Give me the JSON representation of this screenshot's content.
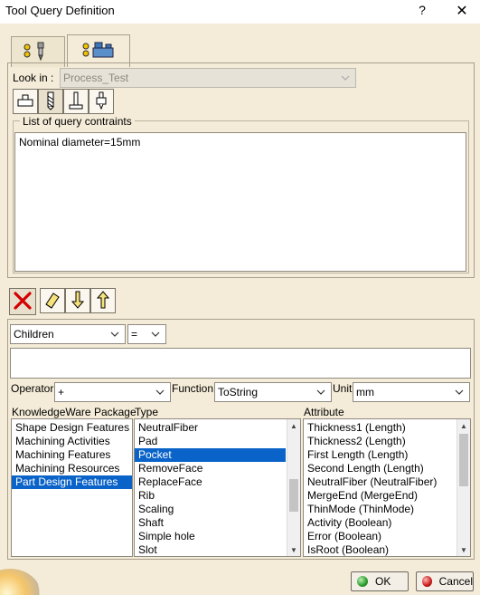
{
  "window": {
    "title": "Tool Query Definition",
    "help": "?",
    "close": "✕"
  },
  "tabs": [
    {
      "icon": "tool-assembly-icon"
    },
    {
      "icon": "machine-resource-icon"
    }
  ],
  "lookin": {
    "label": "Look in :",
    "value": "Process_Test"
  },
  "toolbar_top": [
    "tool-holder-icon",
    "drill-icon",
    "end-mill-icon",
    "insert-tool-icon"
  ],
  "constraints": {
    "legend": "List of query contraints",
    "items": [
      "Nominal diameter=15mm"
    ]
  },
  "toolbar_edit": [
    "delete-icon",
    "eraser-icon",
    "arrow-down-icon",
    "arrow-up-icon"
  ],
  "children_combo": {
    "value": "Children"
  },
  "operator_combo": {
    "value": "="
  },
  "expression_field": {
    "value": ""
  },
  "operator": {
    "label": "Operator",
    "value": "+"
  },
  "function": {
    "label": "Function",
    "value": "ToString"
  },
  "unit": {
    "label": "Unit",
    "value": "mm"
  },
  "kw_package": {
    "label": "KnowledgeWare Package",
    "items": [
      "Shape Design Features",
      "Machining Activities",
      "Machining Features",
      "Machining Resources",
      "Part Design Features"
    ],
    "selected": 4
  },
  "type_list": {
    "label": "Type",
    "items": [
      "NeutralFiber",
      "Pad",
      "Pocket",
      "RemoveFace",
      "ReplaceFace",
      "Rib",
      "Scaling",
      "Shaft",
      "Simple hole",
      "Slot"
    ],
    "selected": 2
  },
  "attribute_list": {
    "label": "Attribute",
    "items": [
      "Thickness1 (Length)",
      "Thickness2 (Length)",
      "First Length (Length)",
      "Second Length (Length)",
      "NeutralFiber (NeutralFiber)",
      "MergeEnd (MergeEnd)",
      "ThinMode (ThinMode)",
      "Activity (Boolean)",
      "Error (Boolean)",
      "IsRoot (Boolean)"
    ]
  },
  "buttons": {
    "ok": "OK",
    "cancel": "Cancel"
  },
  "colors": {
    "accent": "#0a63c8",
    "background": "#f4ecd8",
    "ok_dot": "#2a9a2a",
    "cancel_dot": "#c81a1a",
    "delete_x": "#d40000"
  }
}
